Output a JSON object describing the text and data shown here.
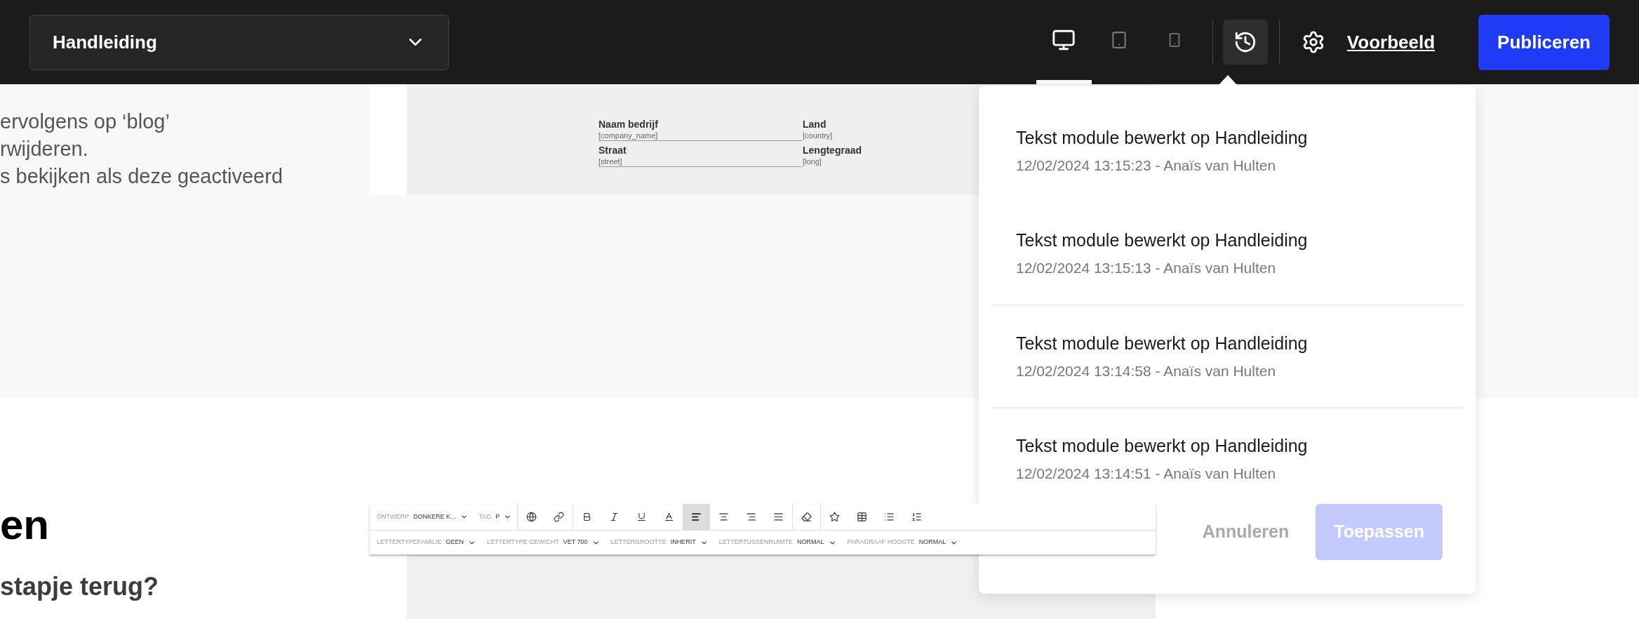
{
  "topbar": {
    "page_select": {
      "value": "Handleiding"
    },
    "devices": [
      {
        "kind": "desktop",
        "selected": true
      },
      {
        "kind": "tablet",
        "selected": false
      },
      {
        "kind": "mobile",
        "selected": false
      }
    ],
    "history_open": true,
    "preview_link": "Voorbeeld",
    "publish_button": "Publiceren"
  },
  "intro_text": {
    "lines": [
      "ervolgens op ‘blog’",
      "rwijderen.",
      "s bekijken als deze geactiveerd"
    ]
  },
  "form_preview": {
    "fields": [
      {
        "label": "Naam bedrijf",
        "value": "[company_name]"
      },
      {
        "label": "Land",
        "value": "[country]"
      },
      {
        "label": "Straat",
        "value": "[street]"
      },
      {
        "label": "Lengtegraad",
        "value": "[long]"
      }
    ]
  },
  "heading": "en",
  "subheading": "stapje terug?",
  "editor_toolbar": {
    "row1_selects": [
      {
        "label": "ONTWERP",
        "value": "DONKERE K..."
      },
      {
        "label": "TAG",
        "value": "P"
      }
    ],
    "tools": [
      {
        "kind": "globe",
        "selected": false
      },
      {
        "kind": "link",
        "selected": false
      },
      {
        "kind": "sep"
      },
      {
        "kind": "bold",
        "selected": false
      },
      {
        "kind": "italic",
        "selected": false
      },
      {
        "kind": "underline",
        "selected": false
      },
      {
        "kind": "color",
        "selected": false
      },
      {
        "kind": "align-left",
        "selected": true
      },
      {
        "kind": "align-center",
        "selected": false
      },
      {
        "kind": "align-right",
        "selected": false
      },
      {
        "kind": "justify",
        "selected": false
      },
      {
        "kind": "sep"
      },
      {
        "kind": "eraser",
        "selected": false
      },
      {
        "kind": "sep"
      },
      {
        "kind": "star",
        "selected": false
      },
      {
        "kind": "table",
        "selected": false
      },
      {
        "kind": "list",
        "selected": false
      },
      {
        "kind": "ordered-list",
        "selected": false
      }
    ],
    "row2_selects": [
      {
        "label": "LETTERTYPEFAMILIE",
        "value": "GEEN"
      },
      {
        "label": "LETTERTYPE GEWICHT",
        "value": "VET 700"
      },
      {
        "label": "LETTERGROOTTE",
        "value": "INHERIT"
      },
      {
        "label": "LETTERTUSSENRUIMTE",
        "value": "NORMAL"
      },
      {
        "label": "PARAGRAAF HOOGTE",
        "value": "NORMAL"
      }
    ]
  },
  "history_popover": {
    "items": [
      {
        "title": "Tekst module bewerkt op Handleiding",
        "meta": "12/02/2024 13:15:23 - Anaïs van Hulten",
        "divider_above": false
      },
      {
        "title": "Tekst module bewerkt op Handleiding",
        "meta": "12/02/2024 13:15:13 - Anaïs van Hulten",
        "divider_above": false
      },
      {
        "title": "Tekst module bewerkt op Handleiding",
        "meta": "12/02/2024 13:14:58 - Anaïs van Hulten",
        "divider_above": true
      },
      {
        "title": "Tekst module bewerkt op Handleiding",
        "meta": "12/02/2024 13:14:51 - Anaïs van Hulten",
        "divider_above": true
      }
    ],
    "cancel_button": "Annuleren",
    "apply_button": {
      "label": "Toepassen",
      "disabled": true
    }
  }
}
